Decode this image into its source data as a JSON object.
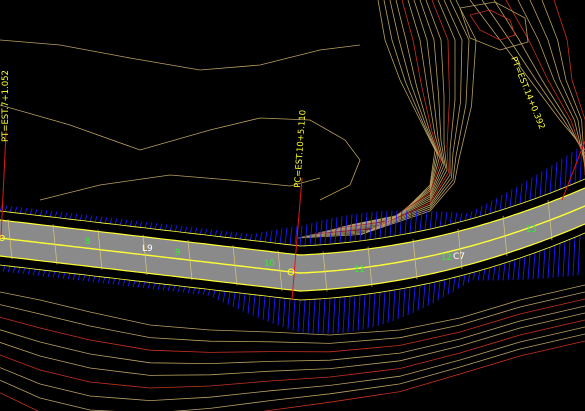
{
  "view": {
    "background": "#000000"
  },
  "colors": {
    "road_fill": "#8a8a8a",
    "road_edge": "#ffff33",
    "centerline": "#ffff33",
    "hatch": "#1a1aff",
    "contour_minor": "#b8a060",
    "contour_major": "#c83020",
    "station_line": "#e01818",
    "station_text": "#ffff33",
    "segment_text": "#ffffff",
    "tick_text": "#33ee33"
  },
  "stations": {
    "pt_left": "PT=EST.7+1.052",
    "pc": "PC=EST.10+5.110",
    "pt_right": "PT=EST.14+0.392"
  },
  "segments": {
    "tangent": "L9",
    "curve": "C7"
  },
  "section_ticks": [
    "8",
    "9",
    "10",
    "11",
    "12",
    "13"
  ]
}
